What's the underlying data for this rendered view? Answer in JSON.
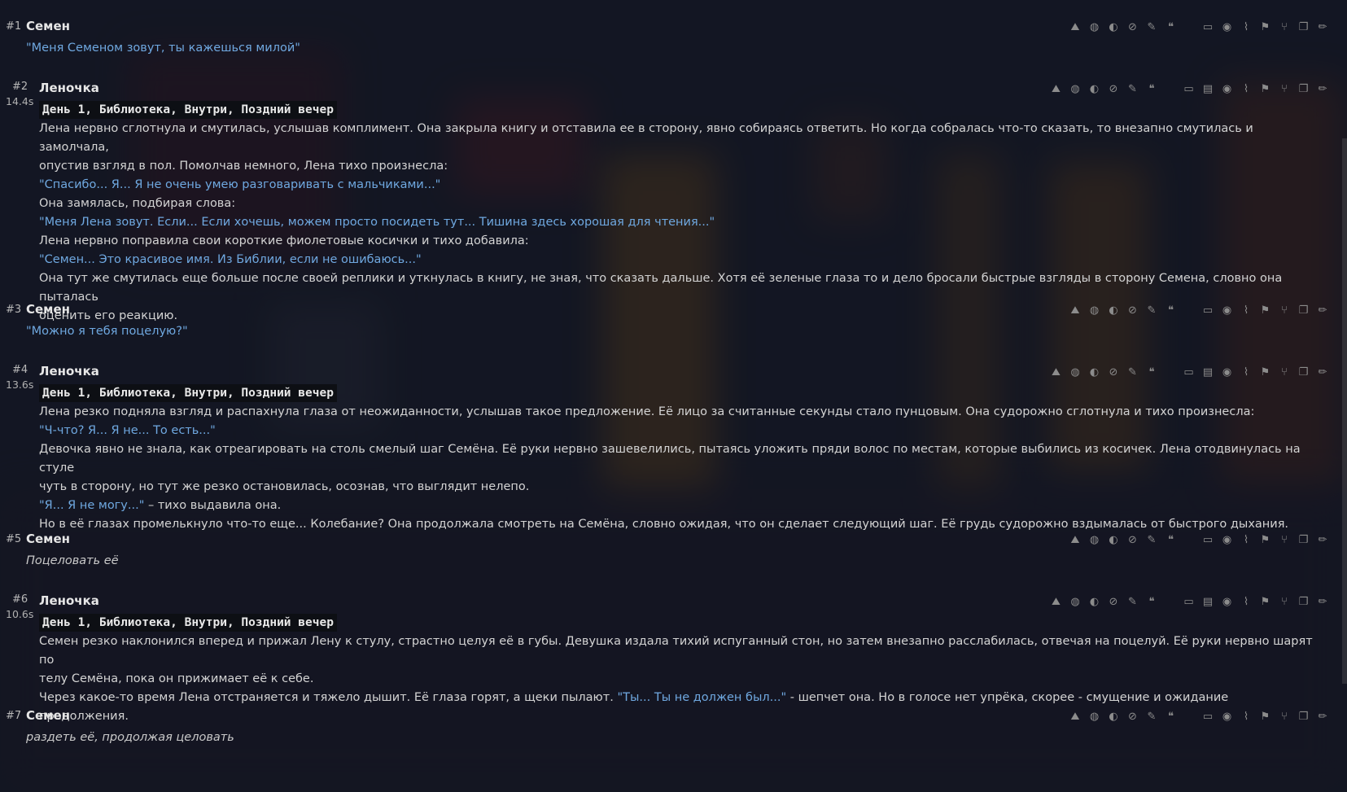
{
  "messages": [
    {
      "id": "#1",
      "name": "Семен",
      "time": "",
      "kind": "user",
      "lines": [
        {
          "segs": [
            {
              "t": "\"Меня Семеном зовут, ты кажешься милой\"",
              "c": "q"
            }
          ]
        }
      ]
    },
    {
      "id": "#2",
      "name": "Леночка",
      "time": "14.4s",
      "kind": "bot",
      "scene": "День 1, Библиотека, Внутри, Поздний вечер",
      "lines": [
        {
          "segs": [
            {
              "t": "Лена нервно сглотнула и смутилась, услышав комплимент. Она закрыла книгу и отставила ее в сторону, явно собираясь ответить. Но когда собралась что-то сказать, то внезапно смутилась и замолчала,",
              "c": ""
            }
          ]
        },
        {
          "segs": [
            {
              "t": "опустив взгляд в пол. Помолчав немного, Лена тихо произнесла:",
              "c": ""
            }
          ]
        },
        {
          "segs": [
            {
              "t": "\"Спасибо... Я... Я не очень умею разговаривать с мальчиками...\"",
              "c": "q"
            }
          ]
        },
        {
          "segs": [
            {
              "t": "Она замялась, подбирая слова:",
              "c": ""
            }
          ]
        },
        {
          "segs": [
            {
              "t": "\"Меня Лена зовут. Если... Если хочешь, можем просто посидеть тут... Тишина здесь хорошая для чтения...\"",
              "c": "q"
            }
          ]
        },
        {
          "segs": [
            {
              "t": "Лена нервно поправила свои короткие фиолетовые косички и тихо добавила:",
              "c": ""
            }
          ]
        },
        {
          "segs": [
            {
              "t": "\"Семен... Это красивое имя. Из Библии, если не ошибаюсь...\"",
              "c": "q"
            }
          ]
        },
        {
          "segs": [
            {
              "t": "Она тут же смутилась еще больше после своей реплики и уткнулась в книгу, не зная, что сказать дальше. Хотя её зеленые глаза то и дело бросали быстрые взгляды в сторону Семена, словно она пыталась",
              "c": ""
            }
          ]
        },
        {
          "segs": [
            {
              "t": "оценить его реакцию.",
              "c": ""
            }
          ]
        }
      ]
    },
    {
      "id": "#3",
      "name": "Семен",
      "time": "",
      "kind": "user",
      "lines": [
        {
          "segs": [
            {
              "t": "\"Можно я тебя поцелую?\"",
              "c": "q"
            }
          ]
        }
      ]
    },
    {
      "id": "#4",
      "name": "Леночка",
      "time": "13.6s",
      "kind": "bot",
      "scene": "День 1, Библиотека, Внутри, Поздний вечер",
      "lines": [
        {
          "segs": [
            {
              "t": "Лена резко подняла взгляд и распахнула глаза от неожиданности, услышав такое предложение. Её лицо за считанные секунды стало пунцовым. Она судорожно сглотнула и тихо произнесла:",
              "c": ""
            }
          ]
        },
        {
          "segs": [
            {
              "t": "\"Ч-что? Я... Я не... То есть...\"",
              "c": "q"
            }
          ]
        },
        {
          "segs": [
            {
              "t": "Девочка явно не знала, как отреагировать на столь смелый шаг Семёна. Её руки нервно зашевелились, пытаясь уложить пряди волос по местам, которые выбились из косичек. Лена отодвинулась на стуле",
              "c": ""
            }
          ]
        },
        {
          "segs": [
            {
              "t": "чуть в сторону, но тут же резко остановилась, осознав, что выглядит нелепо.",
              "c": ""
            }
          ]
        },
        {
          "segs": [
            {
              "t": "\"Я... Я не могу...\"",
              "c": "q"
            },
            {
              "t": " – тихо выдавила она.",
              "c": ""
            }
          ]
        },
        {
          "segs": [
            {
              "t": "Но в её глазах промелькнуло что-то еще... Колебание? Она продолжала смотреть на Семёна, словно ожидая, что он сделает следующий шаг. Её грудь судорожно вздымалась от быстрого дыхания.",
              "c": ""
            }
          ]
        }
      ]
    },
    {
      "id": "#5",
      "name": "Семен",
      "time": "",
      "kind": "user",
      "lines": [
        {
          "segs": [
            {
              "t": "Поцеловать её",
              "c": "em"
            }
          ]
        }
      ]
    },
    {
      "id": "#6",
      "name": "Леночка",
      "time": "10.6s",
      "kind": "bot",
      "scene": "День 1, Библиотека, Внутри, Поздний вечер",
      "lines": [
        {
          "segs": [
            {
              "t": "Семен резко наклонился вперед и прижал Лену к стулу, страстно целуя её в губы. Девушка издала тихий испуганный стон, но затем внезапно расслабилась, отвечая на поцелуй. Её руки нервно шарят по",
              "c": ""
            }
          ]
        },
        {
          "segs": [
            {
              "t": "телу Семёна, пока он прижимает её к себе.",
              "c": ""
            }
          ]
        },
        {
          "segs": [
            {
              "t": "Через какое-то время Лена отстраняется и тяжело дышит. Её глаза горят, а щеки пылают. ",
              "c": ""
            },
            {
              "t": "\"Ты... Ты не должен был...\"",
              "c": "q"
            },
            {
              "t": " - шепчет она. Но в голосе нет упрёка, скорее - смущение и ожидание продолжения.",
              "c": ""
            }
          ]
        }
      ]
    },
    {
      "id": "#7",
      "name": "Семен",
      "time": "",
      "kind": "user",
      "lines": [
        {
          "segs": [
            {
              "t": "раздеть её, продолжая целовать",
              "c": "em"
            }
          ]
        }
      ]
    }
  ],
  "icons_user": [
    "translate-icon",
    "globe-icon",
    "brain-icon",
    "ban-icon",
    "brush-icon",
    "quote-icon",
    "|",
    "alt-text-icon",
    "eye-icon",
    "paperclip-icon",
    "flag-icon",
    "branch-icon",
    "copy-icon",
    "edit-icon"
  ],
  "icons_bot": [
    "translate-icon",
    "globe-icon",
    "brain-icon",
    "ban-icon",
    "brush-icon",
    "quote-icon",
    "|",
    "alt-text-icon",
    "prompt-icon",
    "eye-icon",
    "paperclip-icon",
    "flag-icon",
    "branch-icon",
    "copy-icon",
    "edit-icon"
  ],
  "colors": {
    "quote": "#6fa8e0",
    "text": "#d3d3d3",
    "name": "#e6e6e6",
    "background": "#151a2a"
  }
}
